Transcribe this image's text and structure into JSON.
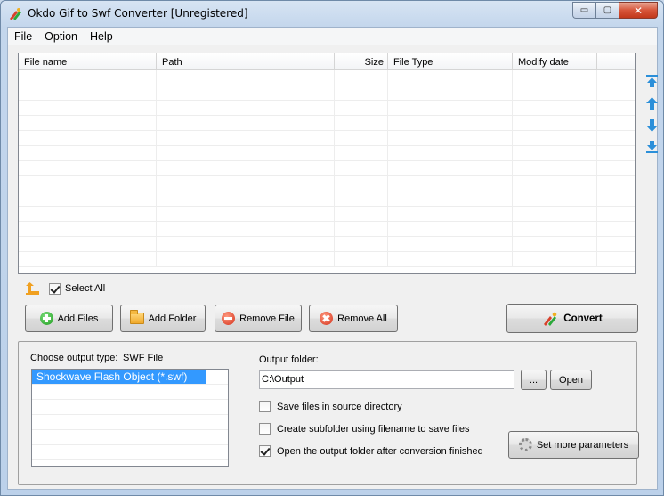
{
  "window": {
    "title": "Okdo Gif to Swf Converter [Unregistered]",
    "controls": {
      "minimize": "▭",
      "maximize": "▢",
      "close": "✕"
    }
  },
  "menu": [
    "File",
    "Option",
    "Help"
  ],
  "file_list": {
    "columns": [
      "File name",
      "Path",
      "Size",
      "File Type",
      "Modify date"
    ],
    "rows": []
  },
  "side_arrows": [
    "move-top-icon",
    "move-up-icon",
    "move-down-icon",
    "move-bottom-icon"
  ],
  "select_all": {
    "label": "Select All",
    "checked": true
  },
  "buttons": {
    "add_files": "Add Files",
    "add_folder": "Add Folder",
    "remove_file": "Remove File",
    "remove_all": "Remove All",
    "convert": "Convert"
  },
  "output": {
    "type_label": "Choose output type:",
    "type_value": "SWF File",
    "type_options": [
      "Shockwave Flash Object (*.swf)"
    ],
    "folder_label": "Output folder:",
    "folder_value": "C:\\Output",
    "browse_label": "...",
    "open_label": "Open",
    "options": [
      {
        "label": "Save files in source directory",
        "checked": false
      },
      {
        "label": "Create subfolder using filename to save files",
        "checked": false
      },
      {
        "label": "Open the output folder after conversion finished",
        "checked": true
      }
    ],
    "more_params_label": "Set more parameters"
  },
  "colors": {
    "selection": "#3399ff",
    "arrow_blue": "#2b8fd9",
    "up_folder_orange": "#f0a020"
  }
}
